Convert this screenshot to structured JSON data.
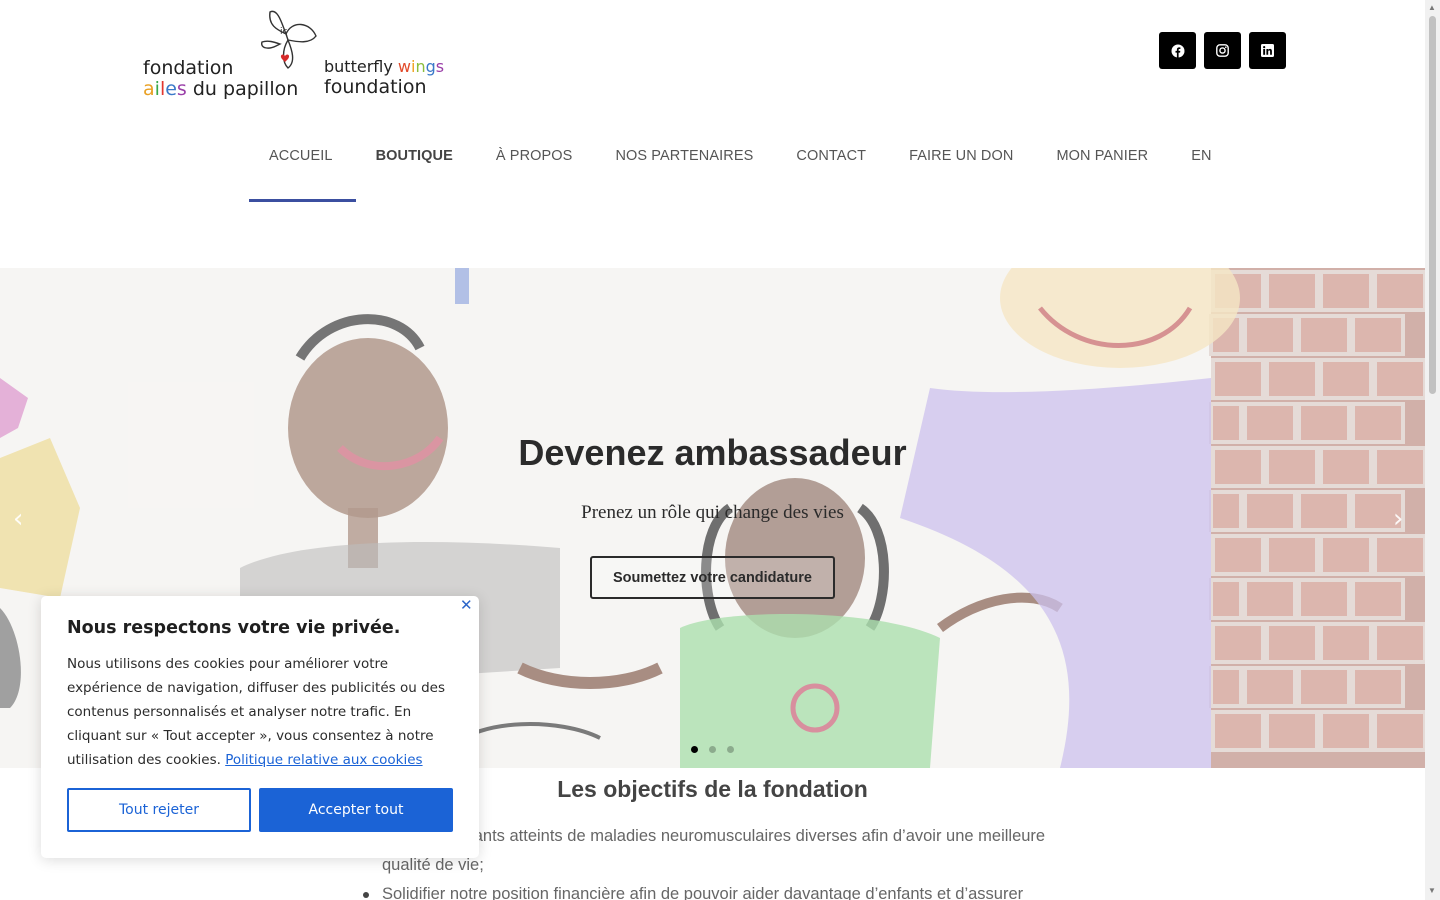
{
  "header": {
    "logo": {
      "left_line1": "fondation",
      "left_line2_parts": [
        "a",
        "i",
        "l",
        "e",
        "s"
      ],
      "left_line2_rest": " du papillon",
      "right_line1": "butterfly ",
      "right_line1_parts": [
        "w",
        "i",
        "n",
        "g",
        "s"
      ],
      "right_line2": "foundation"
    },
    "socials": [
      {
        "icon": "facebook-icon"
      },
      {
        "icon": "instagram-icon"
      },
      {
        "icon": "linkedin-icon"
      }
    ],
    "nav": [
      {
        "label": "ACCUEIL",
        "active": true
      },
      {
        "label": "BOUTIQUE",
        "bold": true
      },
      {
        "label": "À PROPOS"
      },
      {
        "label": "NOS PARTENAIRES"
      },
      {
        "label": "CONTACT"
      },
      {
        "label": "FAIRE UN DON"
      },
      {
        "label": "MON PANIER"
      },
      {
        "label": "EN"
      }
    ],
    "accent_color": "#3b4fa0"
  },
  "hero": {
    "title": "Devenez ambassadeur",
    "subtitle": "Prenez un rôle qui change des vies",
    "button": "Soumettez votre candidature",
    "prev_icon": "‹",
    "next_icon": "›",
    "slide_count": 3,
    "active_slide": 1
  },
  "content": {
    "title": "Les objectifs de la fondation",
    "goals": [
      "Aider les enfants atteints de maladies neuromusculaires diverses afin d’avoir une meilleure",
      "qualité de vie;",
      "Solidifier notre position financière afin de pouvoir aider davantage d’enfants et d’assurer"
    ],
    "goal_visible_prefix_line1": "ants atteints de maladies neuromusculaires diverses afin d’avoir une meilleure"
  },
  "cookie": {
    "title": "Nous respectons votre vie privée.",
    "text": "Nous utilisons des cookies pour améliorer votre expérience de navigation, diffuser des publicités ou des contenus personnalisés et analyser notre trafic. En cliquant sur « Tout accepter », vous consentez à notre utilisation des cookies.",
    "link": "Politique relative aux cookies",
    "reject": "Tout rejeter",
    "accept": "Accepter tout",
    "close_icon": "✕",
    "primary_color": "#1b63d6"
  }
}
